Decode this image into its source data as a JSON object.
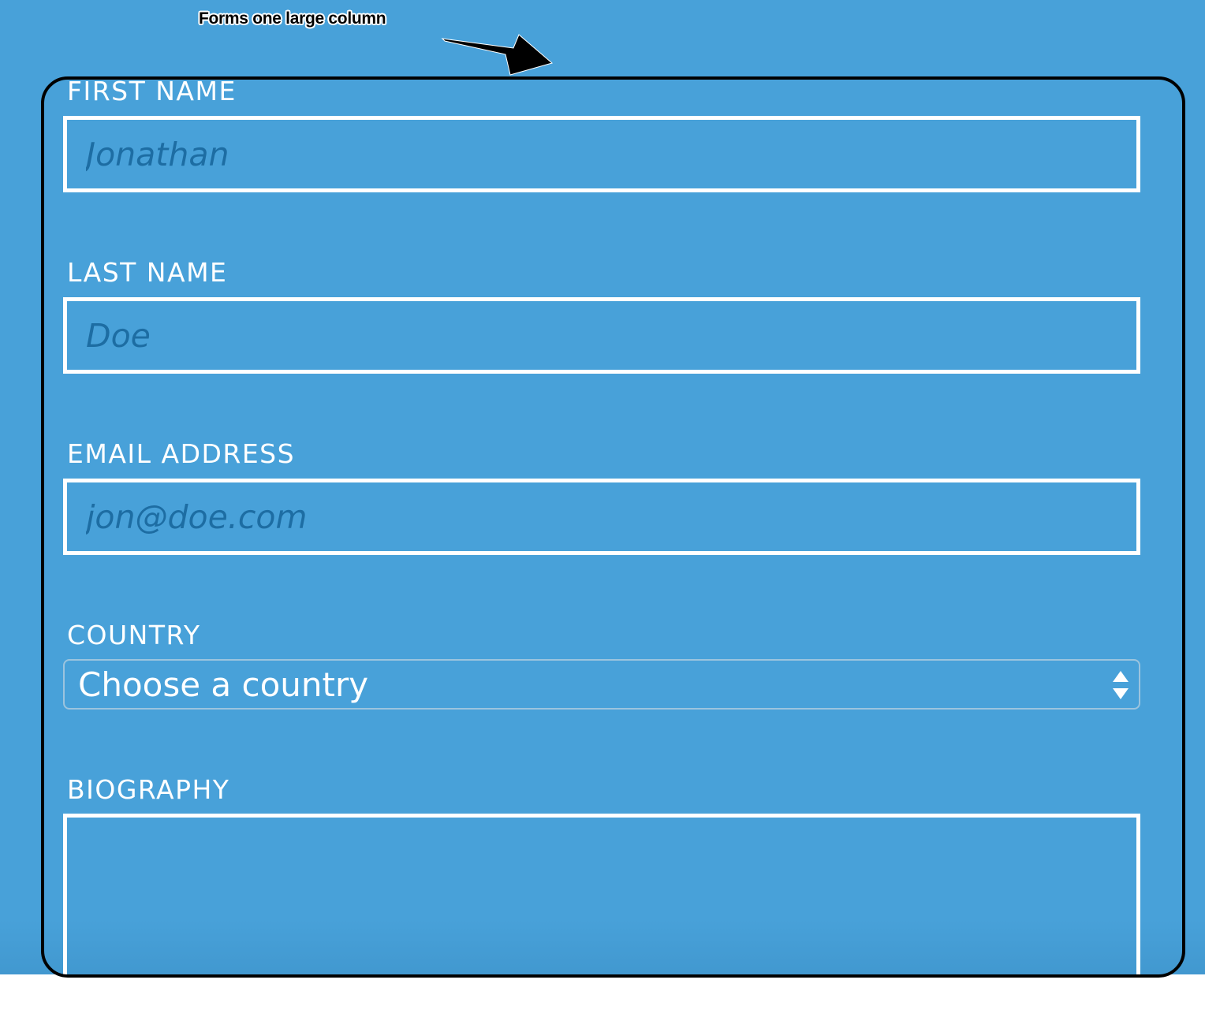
{
  "annotation": {
    "text": "Forms one large column"
  },
  "form": {
    "first_name": {
      "label": "FIRST NAME",
      "placeholder": "Jonathan"
    },
    "last_name": {
      "label": "LAST NAME",
      "placeholder": "Doe"
    },
    "email": {
      "label": "EMAIL ADDRESS",
      "placeholder": "jon@doe.com"
    },
    "country": {
      "label": "COUNTRY",
      "selected": "Choose a country"
    },
    "biography": {
      "label": "BIOGRAPHY"
    }
  },
  "colors": {
    "background": "#48a1d9",
    "placeholder_text": "#1d6da3",
    "label_text": "#ffffff",
    "annotation": "#000000"
  },
  "icons": {
    "annotation_arrow": "arrow-icon",
    "select_arrows": "up-down-arrows-icon"
  }
}
